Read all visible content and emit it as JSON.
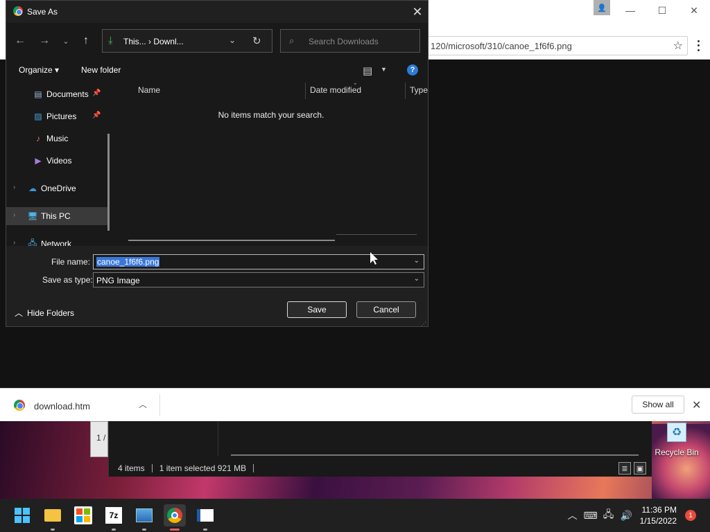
{
  "dialog": {
    "title": "Save As",
    "close_label": "✕",
    "address": {
      "path": "This... › Downl...",
      "arrow": "›"
    },
    "search_placeholder": "Search Downloads",
    "toolbar": {
      "organize": "Organize ▾",
      "new_folder": "New folder",
      "help": "?"
    },
    "nav_items": [
      {
        "label": "Documents",
        "pinned": true
      },
      {
        "label": "Pictures",
        "pinned": true
      },
      {
        "label": "Music",
        "pinned": false
      },
      {
        "label": "Videos",
        "pinned": false
      },
      {
        "label": "OneDrive",
        "expandable": true
      },
      {
        "label": "This PC",
        "expandable": true,
        "selected": true
      },
      {
        "label": "Network",
        "expandable": true
      }
    ],
    "columns": {
      "name": "Name",
      "date_modified": "Date modified",
      "type": "Type"
    },
    "empty_message": "No items match your search.",
    "file_name_label": "File name:",
    "file_name_value": "canoe_1f6f6.png",
    "save_as_type_label": "Save as type:",
    "save_as_type_value": "PNG Image",
    "hide_folders": "Hide Folders",
    "save_button": "Save",
    "cancel_button": "Cancel"
  },
  "browser": {
    "url": "120/microsoft/310/canoe_1f6f6.png"
  },
  "download_bar": {
    "file_name": "download.htm",
    "show_all": "Show all"
  },
  "explorer": {
    "page_indicator": "1 /",
    "status": {
      "items": "4 items",
      "selected": "1 item selected  921 MB"
    }
  },
  "desktop": {
    "recycle_bin": "Recycle Bin"
  },
  "taskbar": {
    "time": "11:36 PM",
    "date": "1/15/2022",
    "notification_count": "1"
  },
  "colors": {
    "selection": "#3a77d8",
    "accent": "#4cc2ff",
    "download_green": "#3fb950",
    "notification": "#e74c3c"
  }
}
